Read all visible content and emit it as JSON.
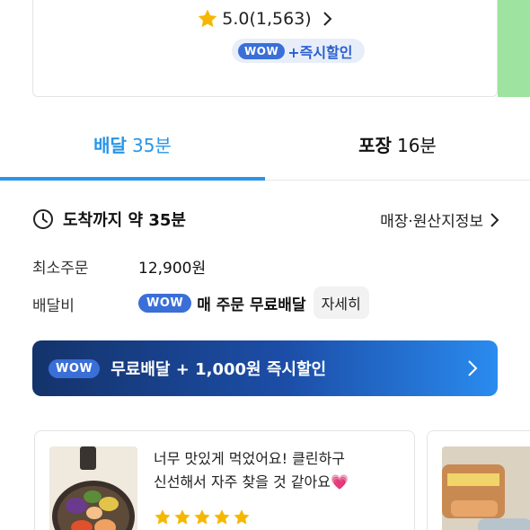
{
  "top_card": {
    "rating": "5.0(1,563)",
    "wow_badge": "WOW",
    "wow_promo": "+즉시할인"
  },
  "tabs": [
    {
      "label": "배달",
      "time": "35분",
      "active": true
    },
    {
      "label": "포장",
      "time": "16분",
      "active": false
    }
  ],
  "delivery": {
    "arrival_text": "도착까지 약 35분",
    "store_info_link": "매장·원산지정보"
  },
  "info": {
    "min_order_label": "최소주문",
    "min_order_value": "12,900원",
    "fee_label": "배달비",
    "fee_wow_badge": "WOW",
    "fee_text": "매 주문 무료배달",
    "detail_button": "자세히"
  },
  "banner": {
    "wow_badge": "WOW",
    "text": "무료배달 + 1,000원 즉시할인"
  },
  "review": {
    "line1": "너무 맛있게 먹었어요! 클린하구",
    "line2": "신선해서 자주 찾을 것 같아요💗",
    "stars": 5
  },
  "colors": {
    "accent_blue": "#2a95e8",
    "wow_blue": "#3a6fd8",
    "star_yellow": "#f5b800",
    "banner_dark": "#14336b"
  }
}
